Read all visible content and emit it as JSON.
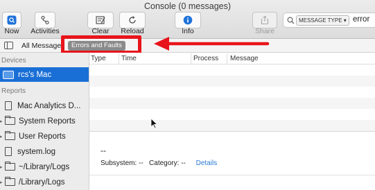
{
  "window": {
    "title": "Console (0 messages)"
  },
  "toolbar": {
    "now_label": "Now",
    "activities_label": "Activities",
    "clear_label": "Clear",
    "reload_label": "Reload",
    "info_label": "Info",
    "share_label": "Share",
    "search": {
      "token": "MESSAGE TYPE ▾",
      "term": "error"
    }
  },
  "filterbar": {
    "all_messages": "All Messages",
    "errors_and_faults": "Errors and Faults"
  },
  "sidebar": {
    "devices_header": "Devices",
    "device": "rcs's Mac",
    "reports_header": "Reports",
    "items": [
      {
        "label": "Mac Analytics D...",
        "icon": "document-icon"
      },
      {
        "label": "System Reports",
        "icon": "folder-icon"
      },
      {
        "label": "User Reports",
        "icon": "folder-icon"
      },
      {
        "label": "system.log",
        "icon": "document-icon"
      },
      {
        "label": "~/Library/Logs",
        "icon": "folder-icon"
      },
      {
        "label": "/Library/Logs",
        "icon": "folder-icon"
      }
    ]
  },
  "table": {
    "columns": [
      "Type",
      "Time",
      "Process",
      "Message"
    ]
  },
  "detail": {
    "dash": "--",
    "subsystem_label": "Subsystem:",
    "subsystem_value": "--",
    "category_label": "Category:",
    "category_value": "--",
    "details_link": "Details"
  },
  "colors": {
    "selection": "#1a6fd6",
    "annotation_red": "#e8141b",
    "link": "#2a7ad6",
    "accent_blue": "#1f72d9"
  }
}
